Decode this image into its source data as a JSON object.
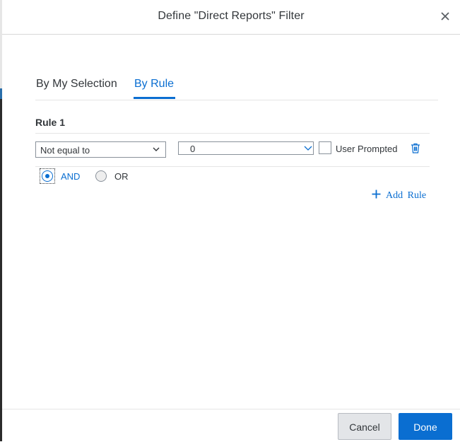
{
  "dialog": {
    "title": "Define \"Direct Reports\" Filter",
    "close_icon": "close-icon"
  },
  "tabs": [
    {
      "label": "By My Selection",
      "selected": false
    },
    {
      "label": "By Rule",
      "selected": true
    }
  ],
  "rule": {
    "label": "Rule 1",
    "operator": {
      "selected": "Not equal to",
      "icon": "chevron-down-icon"
    },
    "value": {
      "text": "0",
      "icon": "chevron-down-icon"
    },
    "user_prompted": {
      "label": "User Prompted",
      "checked": false
    },
    "delete_icon": "trash-icon"
  },
  "logic": {
    "options": [
      {
        "label": "AND",
        "selected": true
      },
      {
        "label": "OR",
        "selected": false
      }
    ]
  },
  "add_rule": {
    "label": "Add Rule",
    "icon": "plus-icon"
  },
  "footer": {
    "cancel_label": "Cancel",
    "done_label": "Done"
  },
  "colors": {
    "accent": "#0a6ed1",
    "text": "#32363a",
    "border": "#89919a"
  }
}
